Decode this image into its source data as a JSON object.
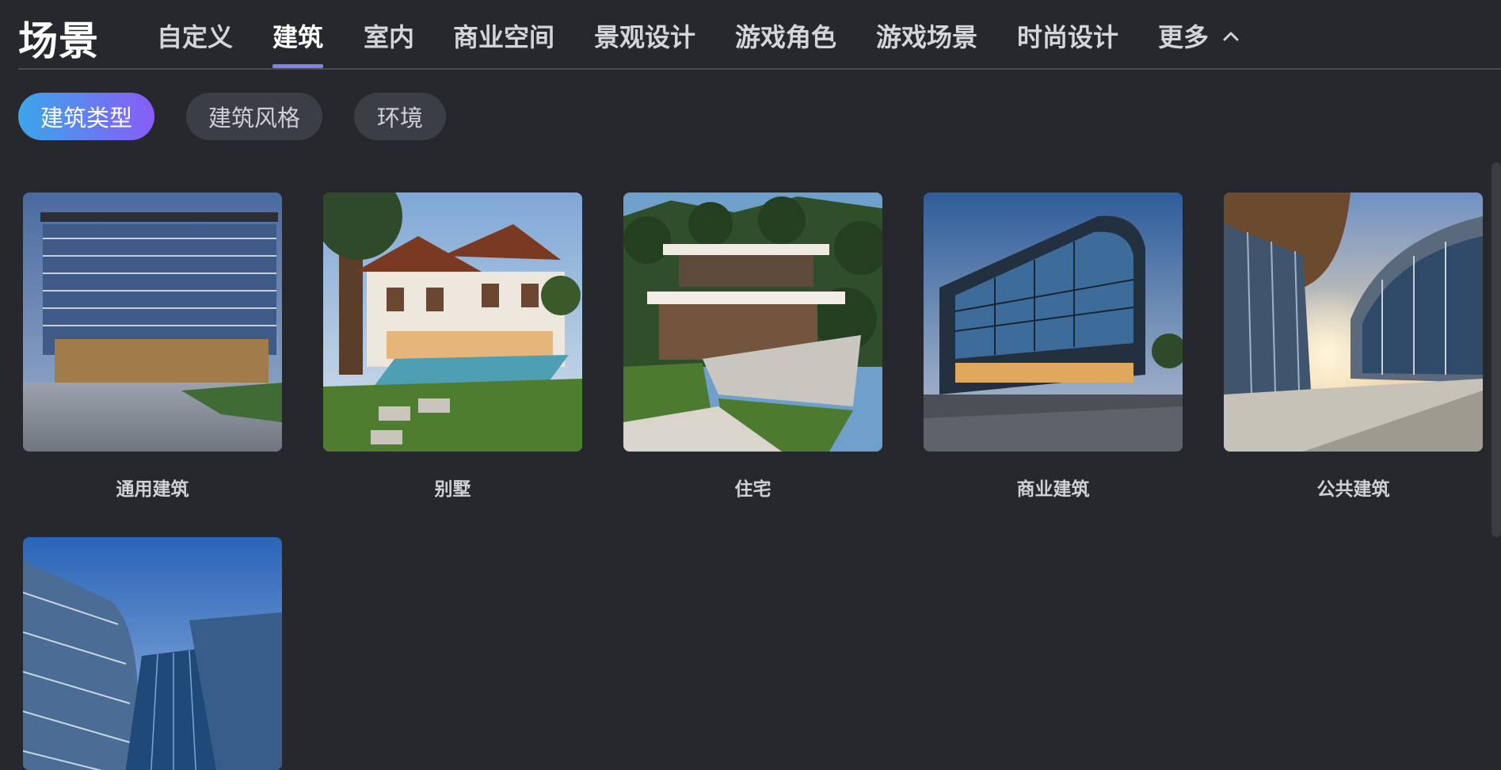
{
  "header": {
    "title": "场景",
    "tabs": [
      {
        "label": "自定义"
      },
      {
        "label": "建筑",
        "active": true
      },
      {
        "label": "室内"
      },
      {
        "label": "商业空间"
      },
      {
        "label": "景观设计"
      },
      {
        "label": "游戏角色"
      },
      {
        "label": "游戏场景"
      },
      {
        "label": "时尚设计"
      },
      {
        "label": "更多",
        "icon": "chevron-up-icon"
      }
    ]
  },
  "subfilters": [
    {
      "label": "建筑类型",
      "active": true
    },
    {
      "label": "建筑风格"
    },
    {
      "label": "环境"
    }
  ],
  "cards": [
    {
      "label": "通用建筑"
    },
    {
      "label": "别墅"
    },
    {
      "label": "住宅"
    },
    {
      "label": "商业建筑"
    },
    {
      "label": "公共建筑"
    },
    {
      "label": ""
    }
  ],
  "colors": {
    "background": "#26282d",
    "accent_underline": "#7c86e8",
    "chip_gradient_start": "#3aa6ea",
    "chip_gradient_end": "#8a5cf6"
  }
}
